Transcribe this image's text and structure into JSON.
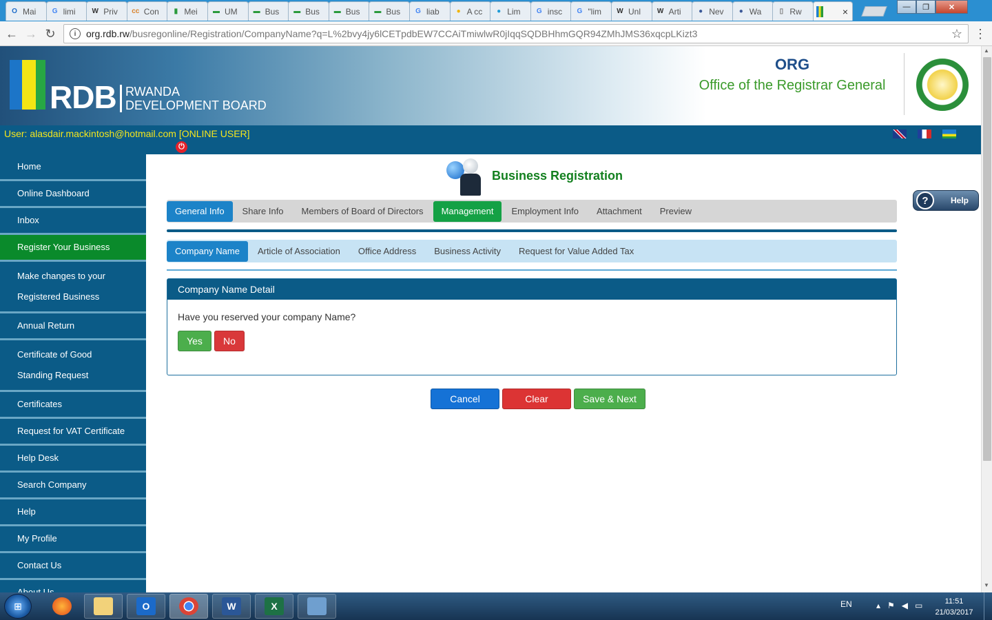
{
  "browser": {
    "tabs": [
      {
        "label": "Mai",
        "fav": "O",
        "color": "#1b6ac9"
      },
      {
        "label": "limi",
        "fav": "G",
        "color": "#4285f4"
      },
      {
        "label": "Priv",
        "fav": "W",
        "color": "#333333"
      },
      {
        "label": "Con",
        "fav": "cc",
        "color": "#d9822b"
      },
      {
        "label": "Mei",
        "fav": "▮",
        "color": "#2a9a3c"
      },
      {
        "label": "UM",
        "fav": "▬",
        "color": "#2a9a3c"
      },
      {
        "label": "Bus",
        "fav": "▬",
        "color": "#2a9a3c"
      },
      {
        "label": "Bus",
        "fav": "▬",
        "color": "#2a9a3c"
      },
      {
        "label": "Bus",
        "fav": "▬",
        "color": "#2a9a3c"
      },
      {
        "label": "Bus",
        "fav": "▬",
        "color": "#2a9a3c"
      },
      {
        "label": "liab",
        "fav": "G",
        "color": "#4285f4"
      },
      {
        "label": "A cc",
        "fav": "●",
        "color": "#f2b400"
      },
      {
        "label": "Lim",
        "fav": "●",
        "color": "#1f9bd7"
      },
      {
        "label": "insc",
        "fav": "G",
        "color": "#4285f4"
      },
      {
        "label": "\"lim",
        "fav": "G",
        "color": "#4285f4"
      },
      {
        "label": "Unl",
        "fav": "W",
        "color": "#333333"
      },
      {
        "label": "Arti",
        "fav": "W",
        "color": "#333333"
      },
      {
        "label": "Nev",
        "fav": "●",
        "color": "#3b5998"
      },
      {
        "label": "Wa",
        "fav": "●",
        "color": "#3b5998"
      },
      {
        "label": "Rw",
        "fav": "▯",
        "color": "#777777"
      }
    ],
    "active_tab_close": "×",
    "url_host": "org.rdb.rw",
    "url_path": "/busregonline/Registration/CompanyName?q=L%2bvy4jy6lCETpdbEW7CCAiTmiwlwR0jIqqSQDBHhmGQR94ZMhJMS36xqcpLKizt3"
  },
  "header": {
    "brand_main": "RDB",
    "brand_sub1": "RWANDA",
    "brand_sub2": "DEVELOPMENT BOARD",
    "org_title": "ORG",
    "org_subtitle": "Office of the Registrar General"
  },
  "userbar": {
    "user_text": "User: alasdair.mackintosh@hotmail.com [ONLINE USER]"
  },
  "sidebar": {
    "items": [
      {
        "label": "Home",
        "lines": 1
      },
      {
        "label": "Online Dashboard",
        "lines": 1
      },
      {
        "label": "Inbox",
        "lines": 1
      },
      {
        "label": "Register Your Business",
        "lines": 1,
        "active": true
      },
      {
        "label": "Make changes to your Registered Business",
        "lines": 2
      },
      {
        "label": "Annual Return",
        "lines": 1
      },
      {
        "label": "Certificate of Good Standing Request",
        "lines": 2
      },
      {
        "label": "Certificates",
        "lines": 1
      },
      {
        "label": "Request for VAT Certificate",
        "lines": 1
      },
      {
        "label": "Help Desk",
        "lines": 1
      },
      {
        "label": "Search Company",
        "lines": 1
      },
      {
        "label": "Help",
        "lines": 1
      },
      {
        "label": "My Profile",
        "lines": 1
      },
      {
        "label": "Contact Us",
        "lines": 1
      },
      {
        "label": "About Us",
        "lines": 1
      }
    ]
  },
  "main": {
    "title": "Business Registration",
    "help_label": "Help",
    "tabs": [
      {
        "label": "General Info",
        "style": "blue"
      },
      {
        "label": "Share Info",
        "style": ""
      },
      {
        "label": "Members of Board of Directors",
        "style": ""
      },
      {
        "label": "Management",
        "style": "green"
      },
      {
        "label": "Employment Info",
        "style": ""
      },
      {
        "label": "Attachment",
        "style": ""
      },
      {
        "label": "Preview",
        "style": ""
      }
    ],
    "subtabs": [
      {
        "label": "Company Name",
        "style": "blue"
      },
      {
        "label": "Article of Association",
        "style": ""
      },
      {
        "label": "Office Address",
        "style": ""
      },
      {
        "label": "Business Activity",
        "style": ""
      },
      {
        "label": "Request for Value Added Tax",
        "style": ""
      }
    ],
    "panel": {
      "heading": "Company Name Detail",
      "question": "Have you reserved your company Name?",
      "yes_label": "Yes",
      "no_label": "No"
    },
    "actions": {
      "cancel": "Cancel",
      "clear": "Clear",
      "save_next": "Save & Next"
    }
  },
  "taskbar": {
    "language": "EN",
    "time": "11:51",
    "date": "21/03/2017"
  }
}
